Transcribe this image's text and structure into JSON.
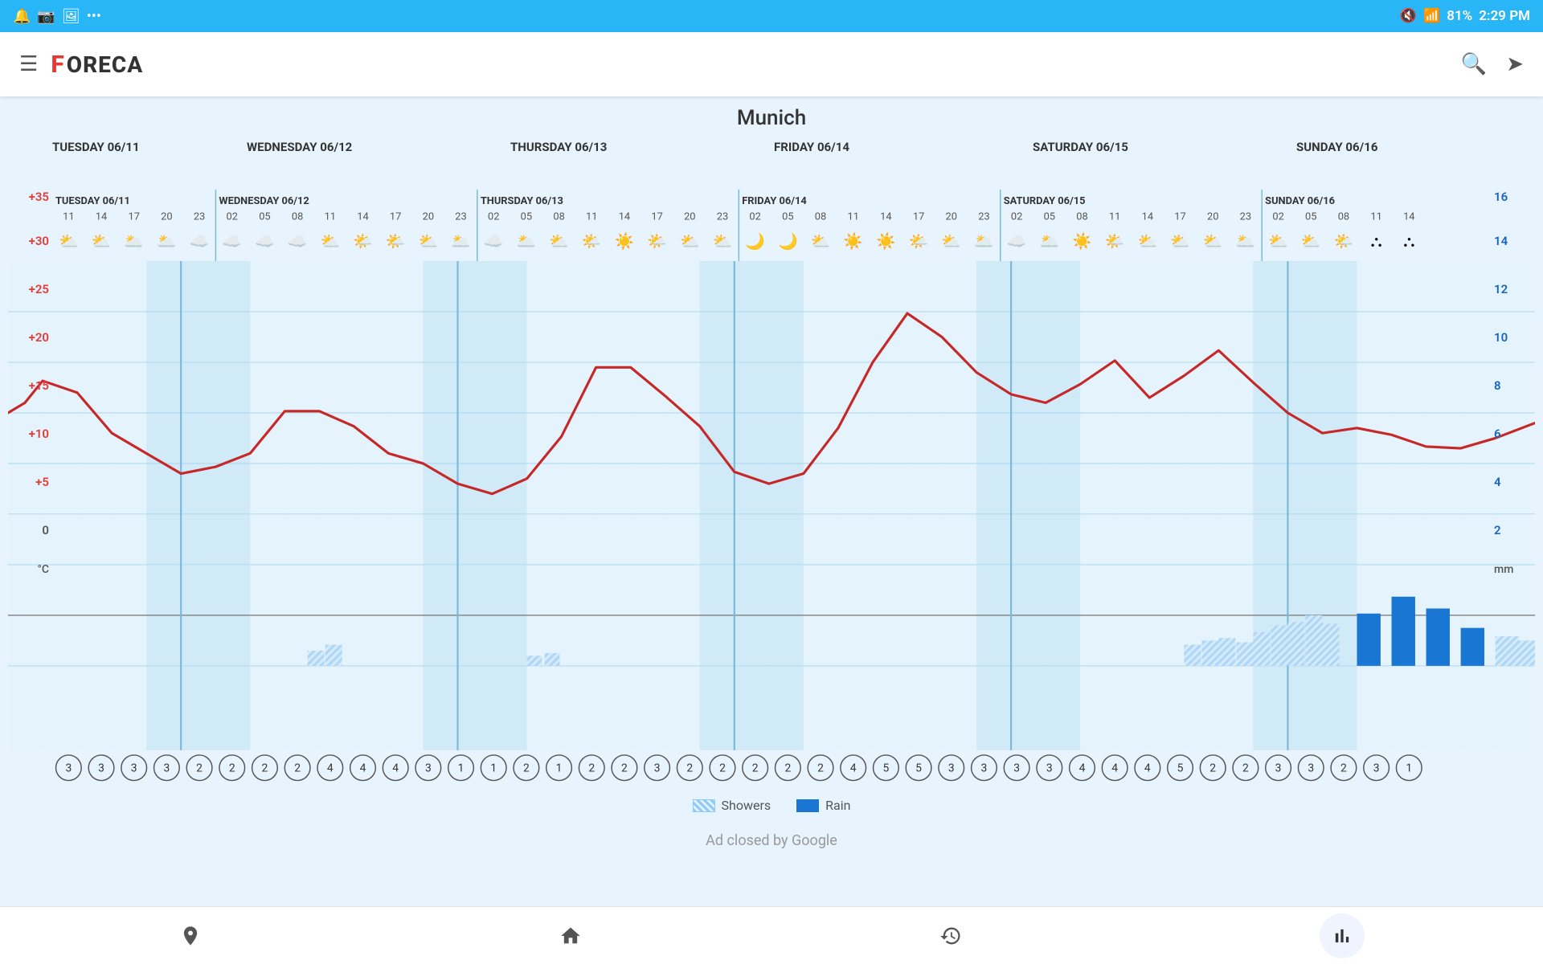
{
  "statusBar": {
    "time": "2:29 PM",
    "battery": "81%",
    "icons": [
      "notification-muted",
      "wifi",
      "battery"
    ]
  },
  "appBar": {
    "title": "FORECA",
    "searchLabel": "search",
    "locationLabel": "location"
  },
  "city": "Munich",
  "days": [
    {
      "label": "TUESDAY 06/11",
      "hours": [
        "11",
        "14",
        "17",
        "20",
        "23"
      ],
      "startHour": "11"
    },
    {
      "label": "WEDNESDAY 06/12",
      "hours": [
        "02",
        "05",
        "08",
        "11",
        "14",
        "17",
        "20",
        "23"
      ],
      "startHour": "02"
    },
    {
      "label": "THURSDAY 06/13",
      "hours": [
        "02",
        "05",
        "08",
        "11",
        "14",
        "17",
        "20",
        "23"
      ],
      "startHour": "02"
    },
    {
      "label": "FRIDAY 06/14",
      "hours": [
        "02",
        "05",
        "08",
        "11",
        "14",
        "17",
        "20",
        "23"
      ],
      "startHour": "02"
    },
    {
      "label": "SATURDAY 06/15",
      "hours": [
        "02",
        "05",
        "08",
        "11",
        "14",
        "17",
        "20",
        "23"
      ],
      "startHour": "02"
    },
    {
      "label": "SUNDAY 06/16",
      "hours": [
        "02",
        "05",
        "08",
        "11",
        "14"
      ],
      "startHour": "02"
    }
  ],
  "yAxisLeft": [
    "+35",
    "+30",
    "+25",
    "+20",
    "+15",
    "+10",
    "+5",
    "0",
    "°C"
  ],
  "yAxisRight": [
    "16",
    "14",
    "12",
    "10",
    "8",
    "6",
    "4",
    "2",
    "mm"
  ],
  "legend": {
    "showers": "Showers",
    "rain": "Rain"
  },
  "adClosed": "Ad closed by Google",
  "bottomNav": {
    "location": "📍",
    "home": "🏠",
    "clock": "🕐",
    "chart": "📊"
  }
}
